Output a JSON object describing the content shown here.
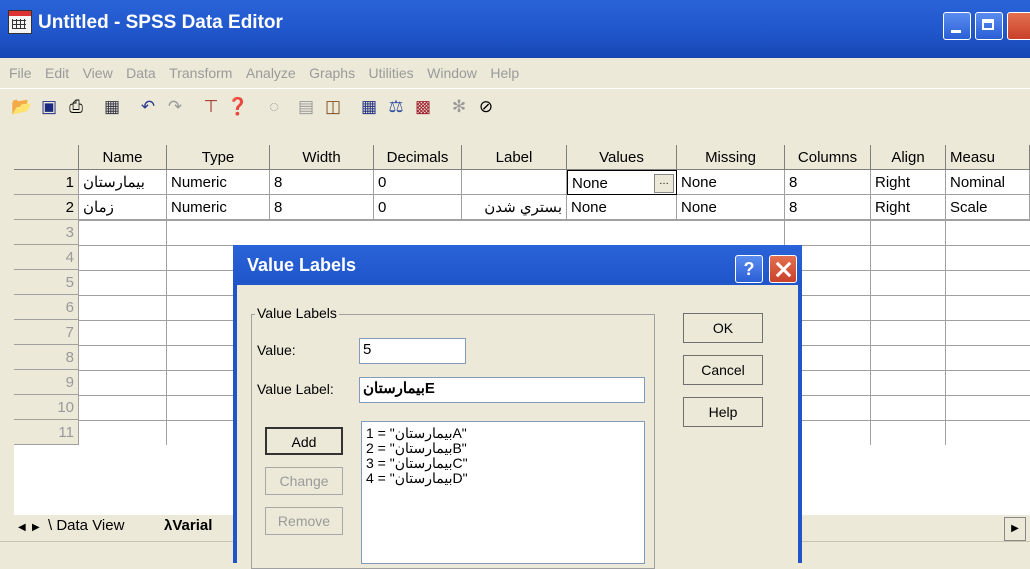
{
  "window": {
    "title": "Untitled - SPSS Data Editor"
  },
  "menu": [
    "File",
    "Edit",
    "View",
    "Data",
    "Transform",
    "Analyze",
    "Graphs",
    "Utilities",
    "Window",
    "Help"
  ],
  "grid": {
    "columns": [
      "Name",
      "Type",
      "Width",
      "Decimals",
      "Label",
      "Values",
      "Missing",
      "Columns",
      "Align",
      "Measu"
    ],
    "rows": [
      {
        "num": "1",
        "name": "بيمارستان",
        "type": "Numeric",
        "width": "8",
        "decimals": "0",
        "label": "",
        "values": "None",
        "missing": "None",
        "columns": "8",
        "align": "Right",
        "measure": "Nominal"
      },
      {
        "num": "2",
        "name": "زمان",
        "type": "Numeric",
        "width": "8",
        "decimals": "0",
        "label": "بستري شدن",
        "values": "None",
        "missing": "None",
        "columns": "8",
        "align": "Right",
        "measure": "Scale"
      }
    ],
    "empty_rows": [
      "3",
      "4",
      "5",
      "6",
      "7",
      "8",
      "9",
      "10",
      "11"
    ]
  },
  "tabs": {
    "data_view": "Data View",
    "variable_view": "Varial"
  },
  "dialog": {
    "title": "Value Labels",
    "group_label": "Value Labels",
    "value_label": "Value:",
    "value": "5",
    "value_label_label": "Value Label:",
    "value_label_value": "بيمارستانE",
    "list": [
      "1 = \"بيمارستانA\"",
      "2 = \"بيمارستانB\"",
      "3 = \"بيمارستانC\"",
      "4 = \"بيمارستانD\""
    ],
    "buttons": {
      "add": "Add",
      "change": "Change",
      "remove": "Remove",
      "ok": "OK",
      "cancel": "Cancel",
      "help": "Help"
    }
  }
}
